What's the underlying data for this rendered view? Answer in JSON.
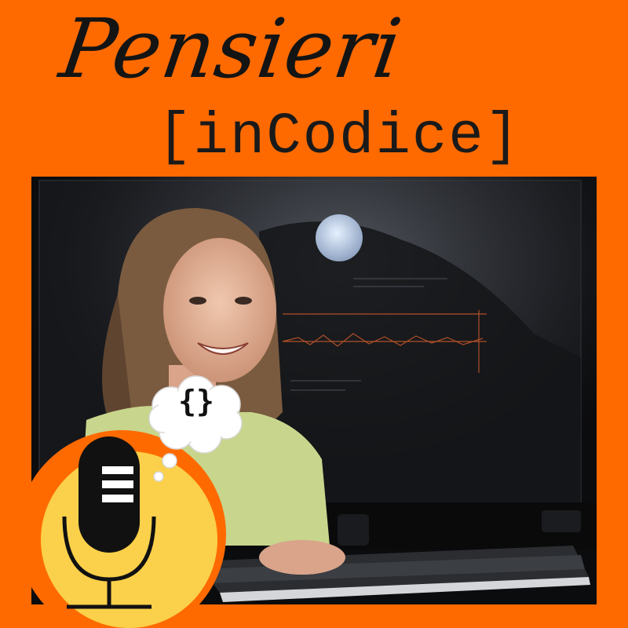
{
  "brand": {
    "title_script": "Pensieri",
    "title_mono": "[inCodice]"
  },
  "thought_bubble": {
    "symbol": "{}"
  },
  "icons": {
    "microphone": "microphone-icon",
    "thought": "thought-bubble-icon"
  },
  "colors": {
    "background": "#ff6a00",
    "badge_inner": "#fbd04a",
    "title_text": "#141414",
    "screen": "#0e0f12"
  }
}
